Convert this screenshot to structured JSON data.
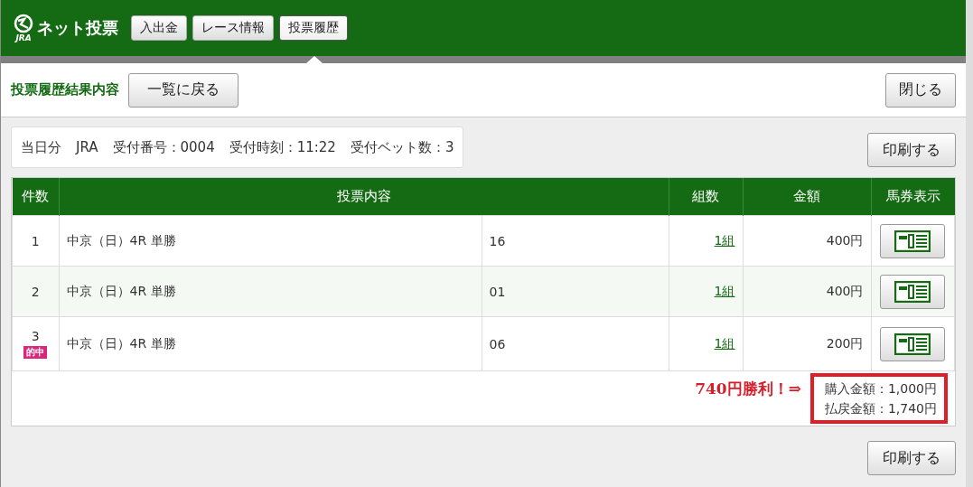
{
  "header": {
    "logo_text": "ネット投票",
    "logo_mark": "JRA",
    "nav": [
      {
        "label": "入出金",
        "selected": false
      },
      {
        "label": "レース情報",
        "selected": false
      },
      {
        "label": "投票履歴",
        "selected": true
      }
    ]
  },
  "page_title": "投票履歴結果内容",
  "back_button": "一覧に戻る",
  "close_button": "閉じる",
  "info": [
    "当日分",
    "JRA",
    "受付番号：0004",
    "受付時刻：11:22",
    "受付ベット数：3"
  ],
  "print_buttons": [
    "印刷する",
    "印刷する"
  ],
  "table": {
    "columns": [
      "件数",
      "投票内容",
      "組数",
      "金額",
      "馬券表示"
    ],
    "rows": [
      {
        "number": "1",
        "race": "中京（日）4R 単勝",
        "selection": "16",
        "combos": "1組",
        "amount": "400円"
      },
      {
        "number": "2",
        "race": "中京（日）4R 単勝",
        "selection": "01",
        "combos": "1組",
        "amount": "400円"
      },
      {
        "number": "3",
        "badge": "的中",
        "race": "中京（日）4R 単勝",
        "selection": "06",
        "combos": "1組",
        "amount": "200円"
      }
    ]
  },
  "summary": {
    "annotation": "740円勝利！⇒",
    "purchase": "購入金額：1,000円",
    "payout": "払戻金額：1,740円"
  }
}
